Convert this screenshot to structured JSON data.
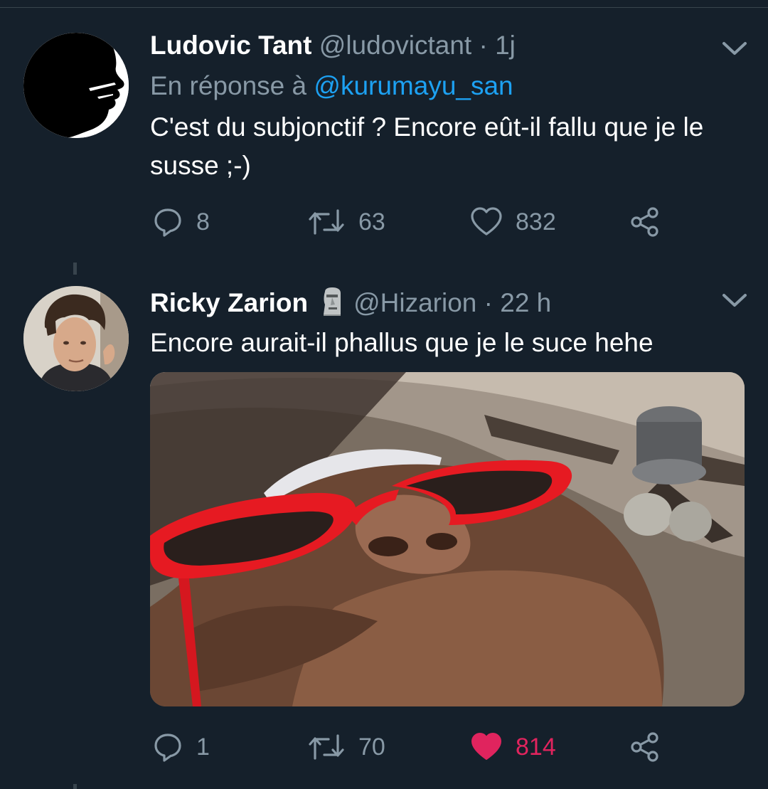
{
  "tweets": [
    {
      "name": "Ludovic Tant",
      "handle": "@ludovictant",
      "separator": "·",
      "time": "1j",
      "reply_prefix": "En réponse à",
      "reply_mention": "@kurumayu_san",
      "text": "C'est du subjonctif ? Encore eût-il fallu que je le susse ;-)",
      "replies": "8",
      "retweets": "63",
      "likes": "832",
      "liked": false,
      "avatar_icon": "silhouette-avatar"
    },
    {
      "name": "Ricky Zarion",
      "name_emoji_icon": "moai-icon",
      "handle": "@Hizarion",
      "separator": "·",
      "time": "22 h",
      "text": "Encore aurait-il phallus que je le suce hehe",
      "media_icon": "photo-red-sunglasses",
      "replies": "1",
      "retweets": "70",
      "likes": "814",
      "liked": true,
      "avatar_icon": "profile-photo-avatar"
    }
  ],
  "colors": {
    "background": "#15202b",
    "secondary_text": "#8899a6",
    "link": "#1da1f2",
    "like_active": "#e0245e",
    "divider": "#38444d"
  }
}
